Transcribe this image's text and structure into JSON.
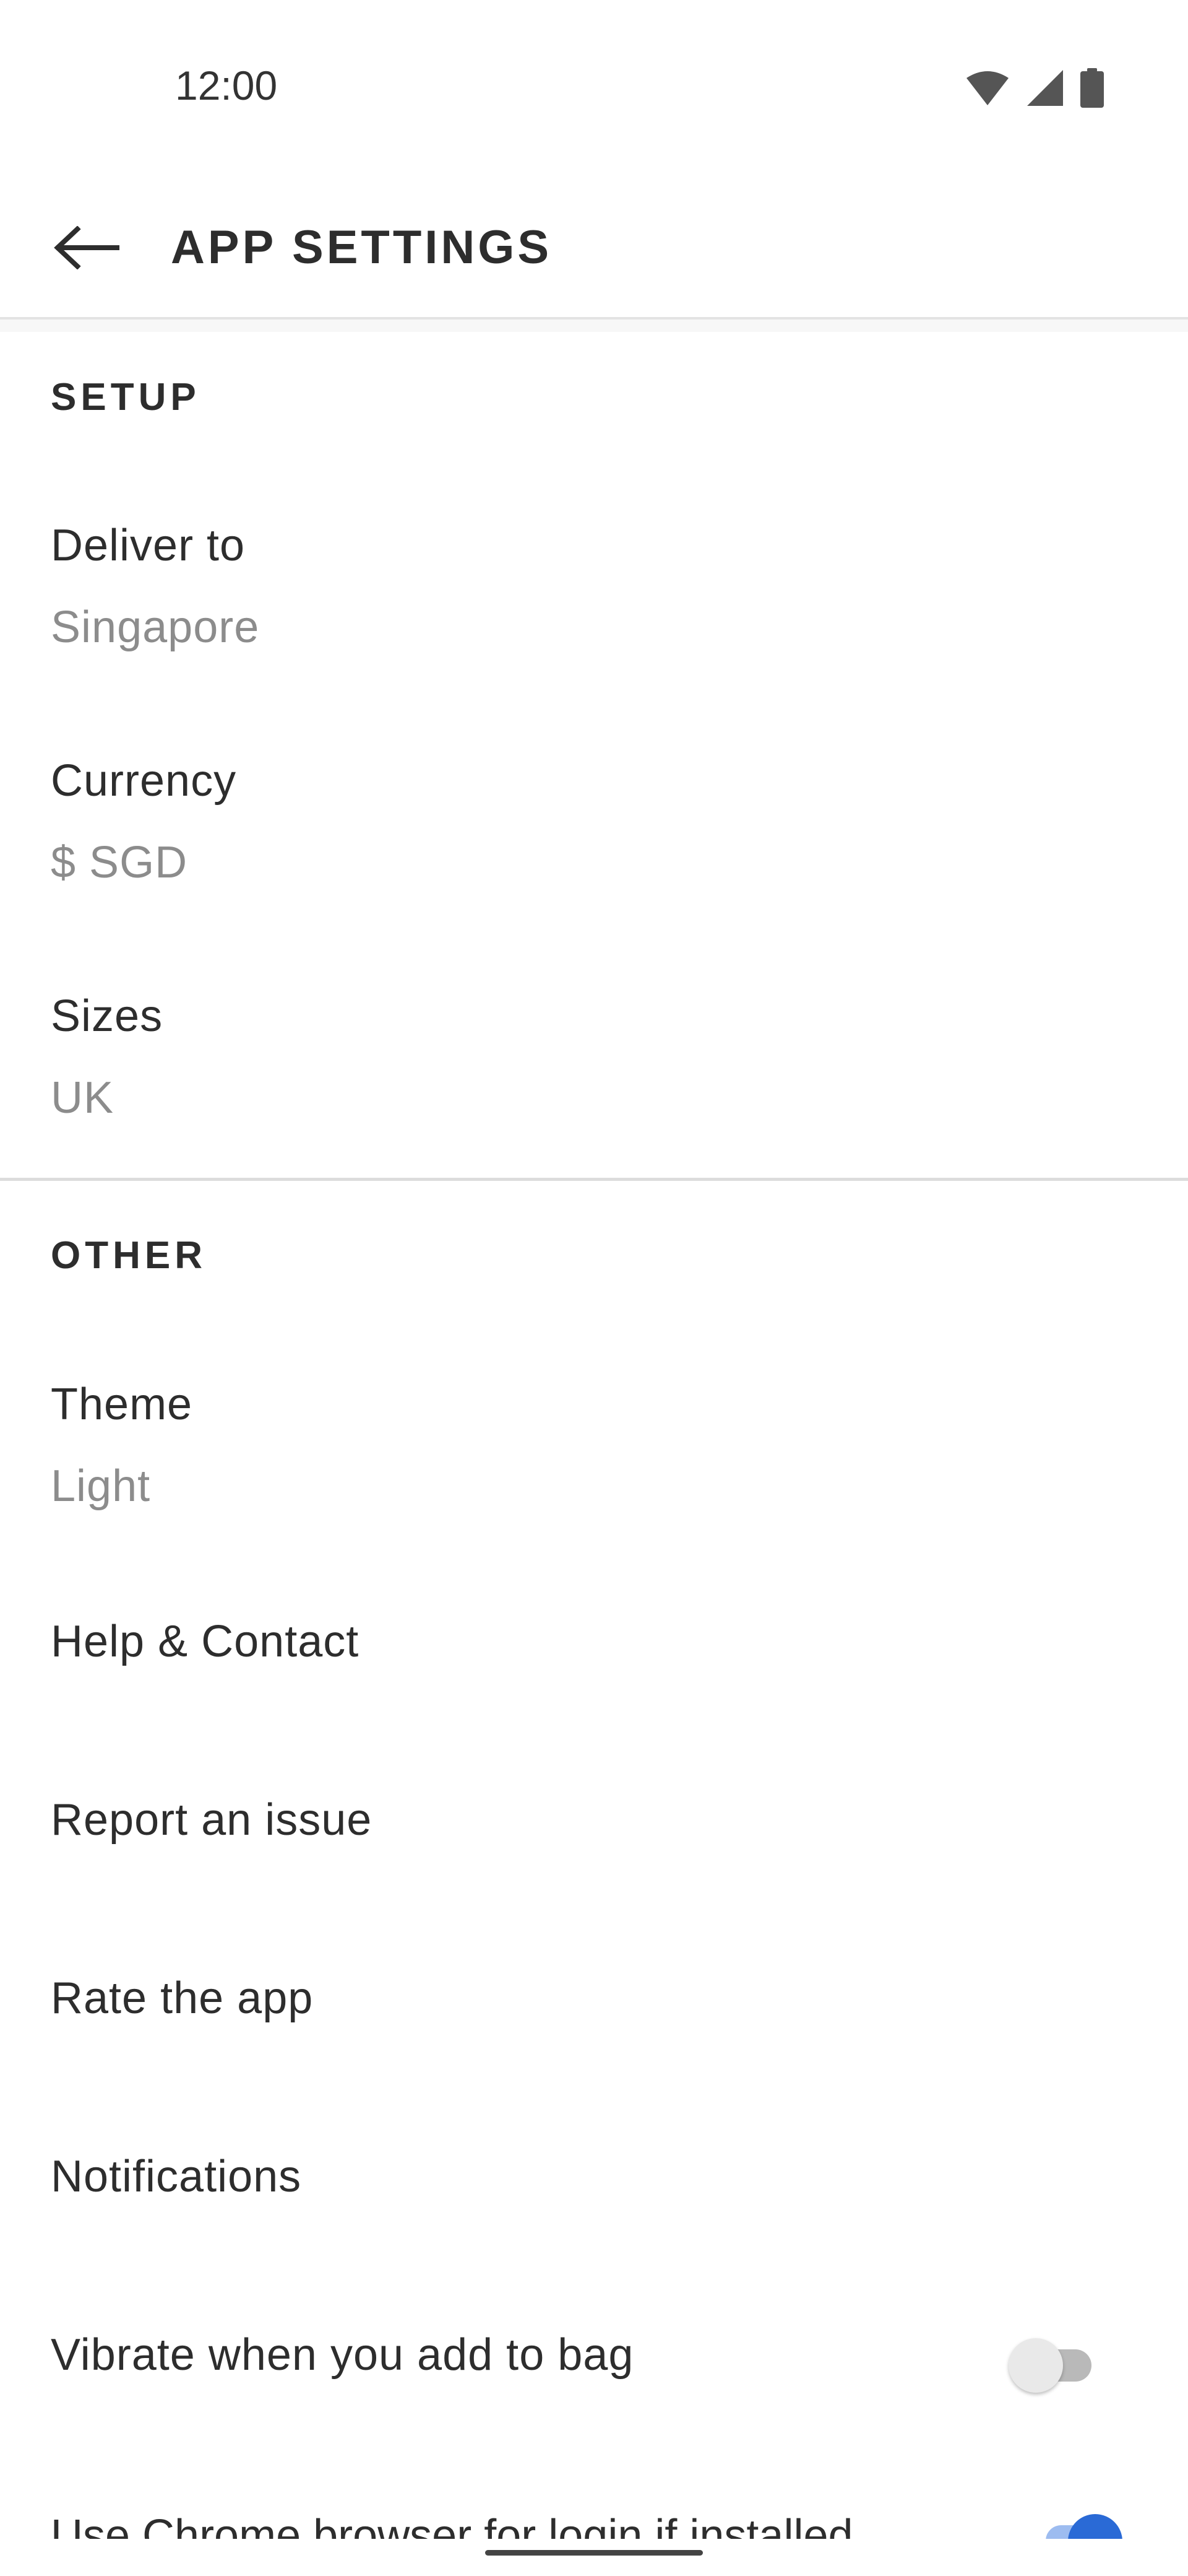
{
  "status_bar": {
    "time": "12:00",
    "icons": [
      "wifi-icon",
      "cellular-signal-icon",
      "battery-icon"
    ]
  },
  "app_bar": {
    "title": "APP SETTINGS",
    "back_icon": "arrow-left-icon"
  },
  "sections": {
    "setup": {
      "title": "SETUP",
      "items": [
        {
          "label": "Deliver to",
          "value": "Singapore"
        },
        {
          "label": "Currency",
          "value": "$ SGD"
        },
        {
          "label": "Sizes",
          "value": "UK"
        }
      ]
    },
    "other": {
      "title": "OTHER",
      "theme": {
        "label": "Theme",
        "value": "Light"
      },
      "help": {
        "label": "Help & Contact"
      },
      "report": {
        "label": "Report an issue"
      },
      "rate": {
        "label": "Rate the app"
      },
      "notifications": {
        "label": "Notifications"
      },
      "vibrate": {
        "label": "Vibrate when you add to bag",
        "enabled": false
      },
      "chrome": {
        "label": "Use Chrome browser for login if installed",
        "enabled": true
      }
    }
  },
  "colors": {
    "accent": "#2a6ad6",
    "text_primary": "#2d2d2d",
    "text_secondary": "#8c8c8c",
    "divider": "#dcdcdc"
  }
}
